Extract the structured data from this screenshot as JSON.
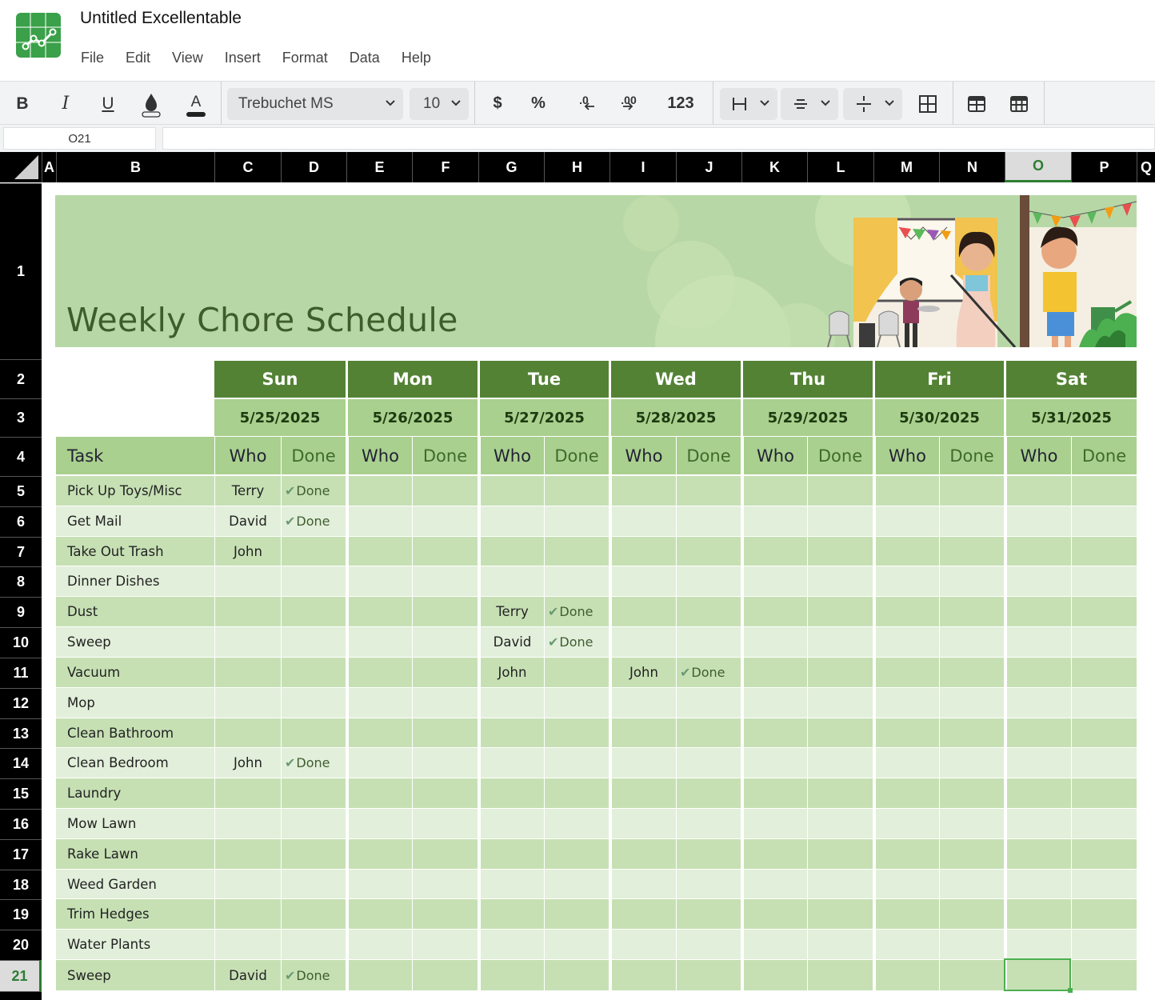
{
  "app": {
    "title": "Untitled Excellentable",
    "menu": [
      "File",
      "Edit",
      "View",
      "Insert",
      "Format",
      "Data",
      "Help"
    ]
  },
  "toolbar": {
    "bold": "B",
    "italic": "I",
    "underline": "U",
    "font_name": "Trebuchet MS",
    "font_size": "10",
    "currency": "$",
    "percent": "%",
    "decrease_decimals": ".0",
    "increase_decimals": ".00",
    "number_format": "123"
  },
  "formula_bar": {
    "name_box": "O21",
    "formula": ""
  },
  "columns": [
    "A",
    "B",
    "C",
    "D",
    "E",
    "F",
    "G",
    "H",
    "I",
    "J",
    "K",
    "L",
    "M",
    "N",
    "O",
    "P",
    "Q"
  ],
  "selected_column": "O",
  "rows": [
    "1",
    "2",
    "3",
    "4",
    "5",
    "6",
    "7",
    "8",
    "9",
    "10",
    "11",
    "12",
    "13",
    "14",
    "15",
    "16",
    "17",
    "18",
    "19",
    "20",
    "21"
  ],
  "selected_row": "21",
  "sheet": {
    "banner_title": "Weekly Chore Schedule",
    "task_header": "Task",
    "who_label": "Who",
    "done_label": "Done",
    "days": [
      {
        "name": "Sun",
        "date": "5/25/2025"
      },
      {
        "name": "Mon",
        "date": "5/26/2025"
      },
      {
        "name": "Tue",
        "date": "5/27/2025"
      },
      {
        "name": "Wed",
        "date": "5/28/2025"
      },
      {
        "name": "Thu",
        "date": "5/29/2025"
      },
      {
        "name": "Fri",
        "date": "5/30/2025"
      },
      {
        "name": "Sat",
        "date": "5/31/2025"
      }
    ],
    "tasks": [
      {
        "task": "Pick Up Toys/Misc",
        "entries": [
          {
            "day": 0,
            "who": "Terry",
            "done": "Done"
          }
        ]
      },
      {
        "task": "Get Mail",
        "entries": [
          {
            "day": 0,
            "who": "David",
            "done": "Done"
          }
        ]
      },
      {
        "task": "Take Out Trash",
        "entries": [
          {
            "day": 0,
            "who": "John",
            "done": ""
          }
        ]
      },
      {
        "task": "Dinner Dishes",
        "entries": []
      },
      {
        "task": "Dust",
        "entries": [
          {
            "day": 2,
            "who": "Terry",
            "done": "Done"
          }
        ]
      },
      {
        "task": "Sweep",
        "entries": [
          {
            "day": 2,
            "who": "David",
            "done": "Done"
          }
        ]
      },
      {
        "task": "Vacuum",
        "entries": [
          {
            "day": 2,
            "who": "John",
            "done": ""
          },
          {
            "day": 3,
            "who": "John",
            "done": "Done"
          }
        ]
      },
      {
        "task": "Mop",
        "entries": []
      },
      {
        "task": "Clean Bathroom",
        "entries": []
      },
      {
        "task": "Clean Bedroom",
        "entries": [
          {
            "day": 0,
            "who": "John",
            "done": "Done"
          }
        ]
      },
      {
        "task": "Laundry",
        "entries": []
      },
      {
        "task": "Mow Lawn",
        "entries": []
      },
      {
        "task": "Rake Lawn",
        "entries": []
      },
      {
        "task": "Weed Garden",
        "entries": []
      },
      {
        "task": "Trim Hedges",
        "entries": []
      },
      {
        "task": "Water Plants",
        "entries": []
      },
      {
        "task": "Sweep",
        "entries": [
          {
            "day": 0,
            "who": "David",
            "done": "Done"
          }
        ]
      }
    ],
    "colors": {
      "banner": "#b7d8a6",
      "day_header": "#548235",
      "subheader": "#a9d08e",
      "row_dark": "#c6e0b4",
      "row_light": "#e2efda",
      "selection": "#4caf50"
    }
  }
}
